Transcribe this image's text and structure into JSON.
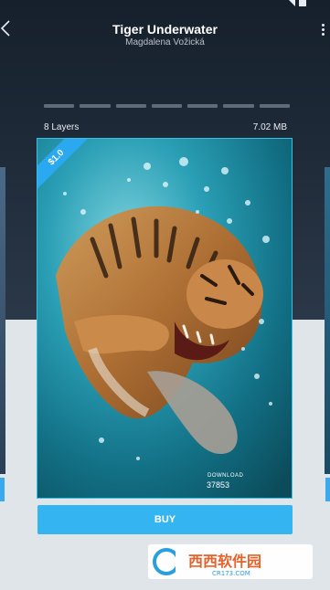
{
  "header": {
    "title": "Tiger Underwater",
    "author": "Magdalena Vožická"
  },
  "status_bar": {
    "time": ""
  },
  "pager": {
    "page_count": 7
  },
  "wallpaper": {
    "layers": "8 Layers",
    "size": "7.02 MB",
    "price": "$1.0",
    "download_label": "DOWNLOAD",
    "download_count": "37853"
  },
  "actions": {
    "buy_label": "BUY"
  },
  "watermark": {
    "text_main": "西西软件园",
    "text_sub": "CR173.COM"
  },
  "icons": {
    "back": "back-arrow-icon",
    "menu": "more-vertical-icon"
  },
  "colors": {
    "accent": "#34b4f0",
    "header_bg": "#1e2a38",
    "body_bg": "#dfe5e9"
  }
}
